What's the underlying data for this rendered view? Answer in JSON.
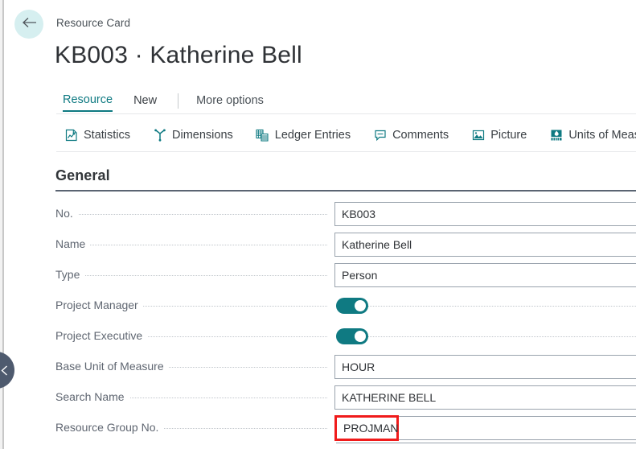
{
  "header": {
    "back_icon": "arrow-left-icon",
    "breadcrumb": "Resource Card",
    "title": "KB003 · Katherine Bell"
  },
  "collapse_handle": {
    "icon": "chevron-left-icon"
  },
  "tabs": [
    {
      "label": "Resource",
      "active": true
    },
    {
      "label": "New",
      "active": false
    },
    {
      "label": "More options",
      "active": false
    }
  ],
  "ribbon": [
    {
      "label": "Statistics",
      "icon": "statistics-chart-icon"
    },
    {
      "label": "Dimensions",
      "icon": "dimensions-icon"
    },
    {
      "label": "Ledger Entries",
      "icon": "ledger-entries-icon"
    },
    {
      "label": "Comments",
      "icon": "comment-bubble-icon"
    },
    {
      "label": "Picture",
      "icon": "picture-image-icon"
    },
    {
      "label": "Units of Measure",
      "icon": "units-of-measure-icon"
    }
  ],
  "section": {
    "title": "General"
  },
  "fields": [
    {
      "label": "No.",
      "type": "text",
      "value": "KB003",
      "highlighted": false
    },
    {
      "label": "Name",
      "type": "text",
      "value": "Katherine Bell",
      "highlighted": false
    },
    {
      "label": "Type",
      "type": "text",
      "value": "Person",
      "highlighted": false
    },
    {
      "label": "Project Manager",
      "type": "toggle",
      "value": "on",
      "highlighted": false
    },
    {
      "label": "Project Executive",
      "type": "toggle",
      "value": "on",
      "highlighted": false
    },
    {
      "label": "Base Unit of Measure",
      "type": "text",
      "value": "HOUR",
      "highlighted": false
    },
    {
      "label": "Search Name",
      "type": "text",
      "value": "KATHERINE BELL",
      "highlighted": false
    },
    {
      "label": "Resource Group No.",
      "type": "text",
      "value": "PROJMAN",
      "highlighted": true
    }
  ],
  "colors": {
    "accent_teal": "#0f7a82",
    "back_button_bg": "#d6eff0",
    "handle_bg": "#4e5a6e",
    "highlight_red": "#f01b1b",
    "section_rule": "#5a6472",
    "field_border": "#9aa3ad"
  }
}
